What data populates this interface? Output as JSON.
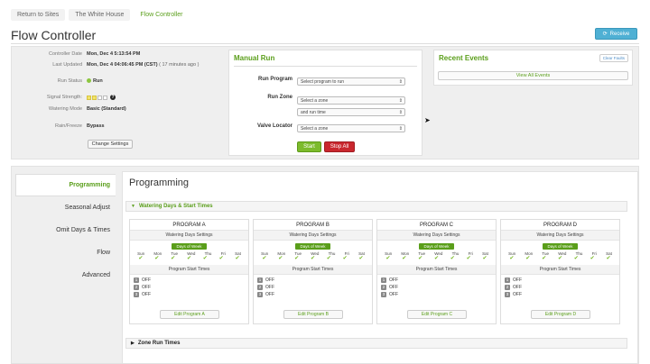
{
  "breadcrumbs": [
    "Return to Sites",
    "The White House",
    "Flow Controller"
  ],
  "page": {
    "title": "Flow Controller",
    "receive_label": "Receive"
  },
  "info": {
    "controller_date_label": "Controller Date",
    "controller_date": "Mon, Dec 4 5:13:54 PM",
    "last_updated_label": "Last Updated",
    "last_updated": "Mon, Dec 4 04:06:45 PM (CST)",
    "last_updated_ago": "( 17 minutes ago )",
    "run_status_label": "Run Status",
    "run_status": "Run",
    "signal_label": "Signal Strength:",
    "signal_level": "2 of 4",
    "watering_mode_label": "Watering Mode",
    "watering_mode": "Basic (Standard)",
    "rain_label": "Rain/Freeze",
    "rain": "Bypass",
    "change_settings": "Change Settings"
  },
  "manual_run": {
    "title": "Manual Run",
    "run_program_label": "Run Program",
    "run_program_placeholder": "Select program to run",
    "run_zone_label": "Run Zone",
    "zone_placeholder": "Select a zone",
    "run_time_placeholder": "and run time",
    "valve_locator_label": "Valve Locator",
    "valve_placeholder": "Select a zone",
    "start": "Start",
    "stop_all": "Stop All"
  },
  "recent_events": {
    "title": "Recent Events",
    "clear_faults": "Clear Faults",
    "view_all": "View All Events"
  },
  "sidenav": [
    "Programming",
    "Seasonal Adjust",
    "Omit Days & Times",
    "Flow",
    "Advanced"
  ],
  "main": {
    "title": "Programming",
    "watering_section": "Watering Days & Start Times",
    "zone_section": "Zone Run Times",
    "watering_days_settings": "Watering Days Settings",
    "days_of_week": "Days of Week",
    "days": [
      "Sun",
      "Mon",
      "Tue",
      "Wed",
      "Thu",
      "Fri",
      "Sat"
    ],
    "program_start_times": "Program Start Times",
    "programs": [
      {
        "name": "PROGRAM A",
        "times": [
          "OFF",
          "OFF",
          "OFF"
        ],
        "edit": "Edit Program A"
      },
      {
        "name": "PROGRAM B",
        "times": [
          "OFF",
          "OFF",
          "OFF"
        ],
        "edit": "Edit Program B"
      },
      {
        "name": "PROGRAM C",
        "times": [
          "OFF",
          "OFF",
          "OFF"
        ],
        "edit": "Edit Program C"
      },
      {
        "name": "PROGRAM D",
        "times": [
          "OFF",
          "OFF",
          "OFF"
        ],
        "edit": "Edit Program D"
      }
    ]
  },
  "colors": {
    "accent": "#5a9e1a",
    "start": "#7cbb2c",
    "stop": "#c9272e",
    "receive": "#4fb0d4"
  }
}
